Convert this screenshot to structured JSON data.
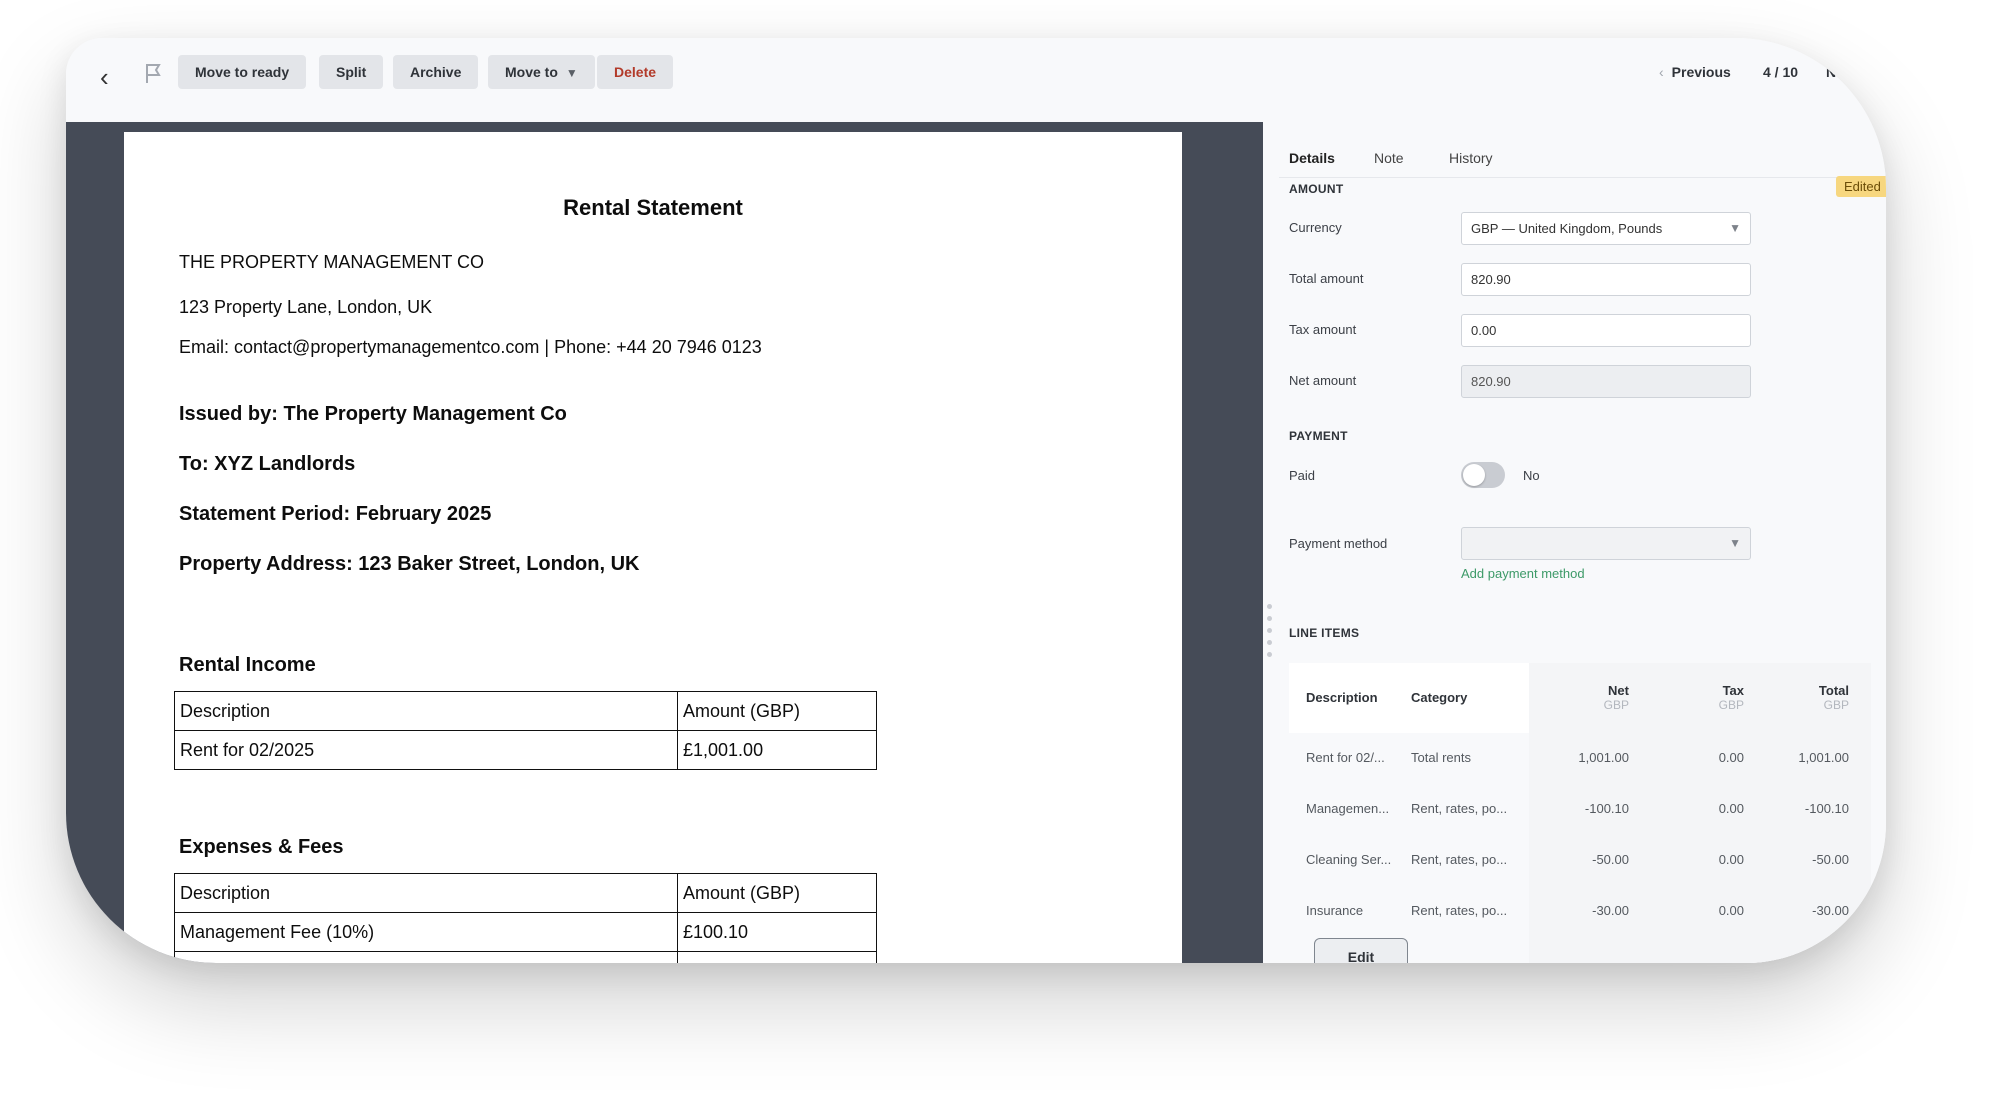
{
  "toolbar": {
    "back_glyph": "‹",
    "buttons": {
      "move_to_ready": "Move to ready",
      "split": "Split",
      "archive": "Archive",
      "move_to": "Move to",
      "delete": "Delete"
    },
    "pager": {
      "previous": "Previous",
      "position": "4 / 10",
      "next": "Nex"
    }
  },
  "document": {
    "title": "Rental Statement",
    "company": "THE PROPERTY MANAGEMENT CO",
    "address": "123 Property Lane, London, UK",
    "contact": "Email: contact@propertymanagementco.com | Phone: +44 20 7946 0123",
    "issued_by": "Issued by: The Property Management Co",
    "to": "To: XYZ Landlords",
    "period": "Statement Period: February 2025",
    "property_address": "Property Address: 123 Baker Street, London, UK",
    "income_heading": "Rental Income",
    "income_table": [
      [
        "Description",
        "Amount (GBP)"
      ],
      [
        "Rent for 02/2025",
        "£1,001.00"
      ]
    ],
    "expenses_heading": "Expenses & Fees",
    "expenses_table": [
      [
        "Description",
        "Amount (GBP)"
      ],
      [
        "Management Fee (10%)",
        "£100.10"
      ]
    ]
  },
  "panel": {
    "tabs": [
      "Details",
      "Note",
      "History"
    ],
    "badge": "Edited",
    "amount": {
      "section": "AMOUNT",
      "currency_label": "Currency",
      "currency_value": "GBP — United Kingdom, Pounds",
      "total_label": "Total amount",
      "total_value": "820.90",
      "tax_label": "Tax amount",
      "tax_value": "0.00",
      "net_label": "Net amount",
      "net_value": "820.90"
    },
    "payment": {
      "section": "PAYMENT",
      "paid_label": "Paid",
      "paid_value": "No",
      "method_label": "Payment method",
      "method_value": "",
      "add_link": "Add payment method"
    },
    "line_items": {
      "section": "LINE ITEMS",
      "columns": {
        "description": "Description",
        "category": "Category",
        "net": "Net",
        "tax": "Tax",
        "total": "Total",
        "currency": "GBP"
      },
      "rows": [
        {
          "description": "Rent for 02/...",
          "category": "Total rents",
          "net": "1,001.00",
          "tax": "0.00",
          "total": "1,001.00"
        },
        {
          "description": "Managemen...",
          "category": "Rent, rates, po...",
          "net": "-100.10",
          "tax": "0.00",
          "total": "-100.10"
        },
        {
          "description": "Cleaning Ser...",
          "category": "Rent, rates, po...",
          "net": "-50.00",
          "tax": "0.00",
          "total": "-50.00"
        },
        {
          "description": "Insurance",
          "category": "Rent, rates, po...",
          "net": "-30.00",
          "tax": "0.00",
          "total": "-30.00"
        }
      ],
      "edit_button": "Edit"
    }
  },
  "colors": {
    "accent_link": "#3d9a68",
    "badge_bg": "#f7d77f",
    "danger": "#b23a2a",
    "viewer_bg": "#454b57"
  }
}
